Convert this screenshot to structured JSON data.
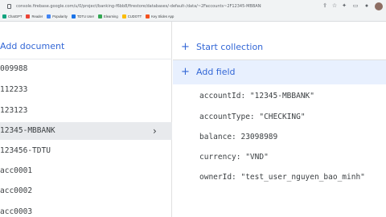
{
  "browser": {
    "url": "console.firebase.google.com/u/0/project/banking-f6bb8/firestore/databases/-default-/data/~2Faccounts~2F12345-MBBANK",
    "bookmarks": [
      "ChatGPT",
      "Reader",
      "Popularity",
      "TDTU User",
      "Elearning",
      "CUDOTT",
      "Key Slides App"
    ]
  },
  "left_panel": {
    "add_document_label": "Add document",
    "documents": [
      "009988",
      "112233",
      "123123",
      "12345-MBBANK",
      "123456-TDTU",
      "acc0001",
      "acc0002",
      "acc0003"
    ],
    "selected_index": 3
  },
  "right_panel": {
    "start_collection_label": "Start collection",
    "add_field_label": "Add field",
    "fields": [
      {
        "text": "accountId: \"12345-MBBANK\""
      },
      {
        "text": "accountType: \"CHECKING\""
      },
      {
        "text": "balance: 23098989"
      },
      {
        "text": "currency: \"VND\""
      },
      {
        "text": "ownerId: \"test_user_nguyen_bao_minh\""
      }
    ]
  },
  "colors": {
    "accent": "#3367d6",
    "selected_bg": "#e8eaed",
    "add_field_bg": "#e8f0fe"
  }
}
